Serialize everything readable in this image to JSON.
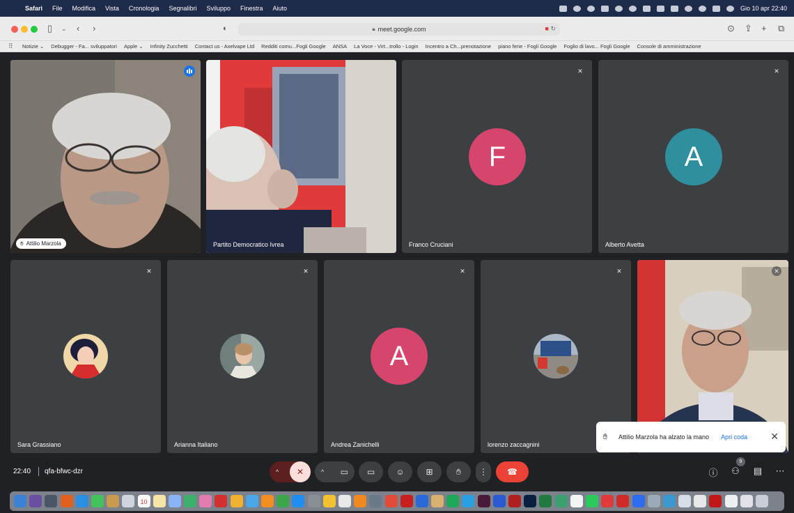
{
  "menubar": {
    "app": "Safari",
    "items": [
      "File",
      "Modifica",
      "Vista",
      "Cronologia",
      "Segnalibri",
      "Sviluppo",
      "Finestra",
      "Aiuto"
    ],
    "datetime": "Gio 10 apr  22:40"
  },
  "browser": {
    "url": "meet.google.com",
    "bookmarks": [
      "Notizie ⌄",
      "Debugger - Fa... sviluppatori",
      "Apple ⌄",
      "Infinity Zucchetti",
      "Contact us - Axelvape Ltd",
      "Redditi comu...Fogli Google",
      "ANSA",
      "La Voce - Virt...trollo - Login",
      "Incentro a Ch...prenotazione",
      "piano ferie - Fogli Google",
      "Foglio di lavo... Fogli Google",
      "Console di amministrazione"
    ]
  },
  "participants": [
    {
      "name": "Attilio Marzola"
    },
    {
      "name": "Partito Democratico Ivrea"
    },
    {
      "name": "Franco Cruciani",
      "initial": "F"
    },
    {
      "name": "Alberto Avetta",
      "initial": "A"
    },
    {
      "name": "Sara Grassiano"
    },
    {
      "name": "Arianna Italiano"
    },
    {
      "name": "Andrea Zanichelli",
      "initial": "A"
    },
    {
      "name": "lorenzo zaccagnini"
    }
  ],
  "colors": {
    "franco": "#d6456b",
    "alberto": "#2f8f9e",
    "andrea": "#d6456b",
    "meet_bg": "#202124",
    "tile_bg": "#3c4043",
    "end_call": "#ea4335",
    "accent": "#1a73e8"
  },
  "toast": {
    "message": "Attilio Marzola ha alzato la mano",
    "action": "Apri coda"
  },
  "controls": {
    "time": "22:40",
    "meeting_code": "qfa-bfwc-dzr",
    "people_count": "9"
  },
  "dock": {
    "calendar_day": "10",
    "edge_text": "e O"
  }
}
